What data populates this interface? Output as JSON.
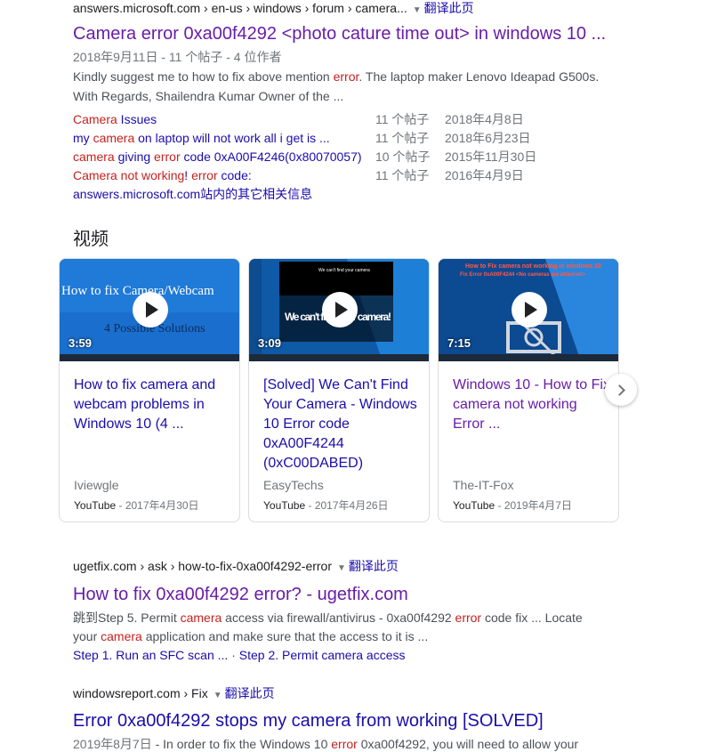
{
  "results": {
    "r1": {
      "cite": "answers.microsoft.com › en-us › windows › forum › camera...",
      "translate": "翻译此页",
      "title": "Camera error 0xa00f4292 <photo cature time out> in windows 10 ...",
      "date": "2018年9月11日 - 11 个帖子 - 4 位作者",
      "snippet_1a": "Kindly suggest me to how to fix above mention ",
      "snippet_1b": "error",
      "snippet_1c": ". The laptop maker Lenovo Ideapad G500s.",
      "snippet_2": "With Regards, Shailendra Kumar Owner of the ...",
      "sub": [
        {
          "p1": "Camera",
          "p2": " Issues",
          "p3": "",
          "p4": "",
          "p5": "",
          "posts": "11 个帖子",
          "date": "2018年4月8日"
        },
        {
          "p1": "my ",
          "p2": "camera",
          "p3": " on laptop will not work all i get is ...",
          "p4": "",
          "p5": "",
          "posts": "11 个帖子",
          "date": "2018年6月23日"
        },
        {
          "p1": "camera",
          "p2": " giving ",
          "p3": "error",
          "p4": " code 0xA00F4246(0x80070057)",
          "p5": "",
          "posts": "10 个帖子",
          "date": "2015年11月30日"
        },
        {
          "p1": "Camera not working",
          "p2": "! ",
          "p3": "error",
          "p4": " code:",
          "p5": "",
          "posts": "11 个帖子",
          "date": "2016年4月9日"
        }
      ],
      "more": "answers.microsoft.com站内的其它相关信息"
    },
    "r2": {
      "cite": "ugetfix.com › ask › how-to-fix-0xa00f4292-error",
      "translate": "翻译此页",
      "title": "How to fix 0xa00f4292 error? - ugetfix.com",
      "s1a": "跳到Step 5. Permit ",
      "s1b": "camera",
      "s1c": " access via firewall/antivirus",
      "s1d": " - 0xa00f4292 ",
      "s1e": "error",
      "s1f": " code fix ... Locate",
      "s2a": "your ",
      "s2b": "camera",
      "s2c": " application and make sure that the access to it is ...",
      "link1": "Step 1. Run an SFC scan ...",
      "sep": " · ",
      "link2": "Step 2. Permit camera access"
    },
    "r3": {
      "cite": "windowsreport.com › Fix",
      "translate": "翻译此页",
      "title": "Error 0xa00f4292 stops my camera from working [SOLVED]",
      "date": "2019年8月7日",
      "s1a": " - In order to fix the Windows 10 ",
      "s1b": "error",
      "s1c": " 0xa00f4292, you will need to allow your"
    }
  },
  "videos": {
    "heading": "视频",
    "items": [
      {
        "thumb_text_1": "How to fix Camera/Webcam",
        "thumb_text_2": "4 Possible Solutions",
        "duration": "3:59",
        "title": "How to fix camera and webcam problems in Windows 10 (4 ...",
        "source": "Iviewgle",
        "platform": "YouTube",
        "date": " - 2017年4月30日"
      },
      {
        "thumb_text_1": "We can't find your camera",
        "thumb_text_2": "We can't find your camera!",
        "duration": "3:09",
        "title": "[Solved] We Can't Find Your Camera - Windows 10 Error code 0xA00F4244 (0xC00DABED)",
        "source": "EasyTechs",
        "platform": "YouTube",
        "date": " - 2017年4月26日"
      },
      {
        "thumb_text_1": "How to Fix camera not working in windows 10",
        "thumb_text_2": "Fix Error 0xA00F4244 <No cameras are attached>",
        "duration": "7:15",
        "title": "Windows 10 - How to Fix camera not working Error ...",
        "source": "The-IT-Fox",
        "platform": "YouTube",
        "date": " - 2019年4月7日"
      }
    ]
  },
  "colors": {
    "link": "#1a0dab",
    "visited": "#681da8",
    "emphasis": "#c5221f",
    "text": "#4d5156"
  }
}
